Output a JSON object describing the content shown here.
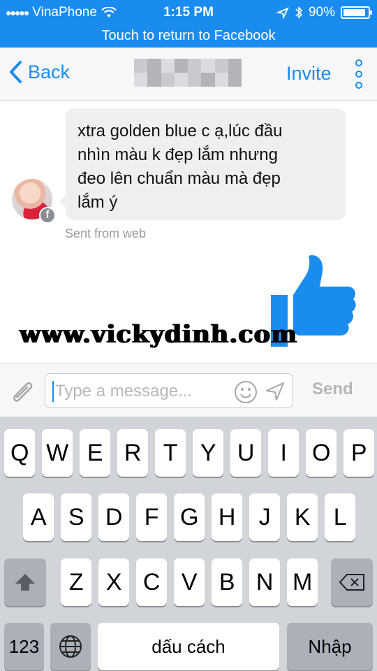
{
  "status_bar": {
    "carrier": "VinaPhone",
    "time": "1:15 PM",
    "battery": "90%",
    "battery_level": 0.9
  },
  "return_banner": "Touch to return to Facebook",
  "nav": {
    "back_label": "Back",
    "invite_label": "Invite"
  },
  "message": {
    "lines": [
      "xtra golden blue c ạ,lúc đầu",
      "nhìn màu k đẹp lắm nhưng",
      "đeo lên chuẩn màu mà đẹp",
      "lắm ý"
    ],
    "meta": "Sent from web"
  },
  "watermark": "www.vickydinh.com",
  "composer": {
    "placeholder": "Type a message...",
    "send_label": "Send"
  },
  "keyboard": {
    "row1": [
      "Q",
      "W",
      "E",
      "R",
      "T",
      "Y",
      "U",
      "I",
      "O",
      "P"
    ],
    "row2": [
      "A",
      "S",
      "D",
      "F",
      "G",
      "H",
      "J",
      "K",
      "L"
    ],
    "row3": [
      "Z",
      "X",
      "C",
      "V",
      "B",
      "N",
      "M"
    ],
    "numbers_label": "123",
    "space_label": "dấu cách",
    "return_label": "Nhập"
  },
  "colors": {
    "accent": "#1a8cf0",
    "bubble": "#efeff1",
    "keyboard_bg": "#d1d4d9"
  },
  "icons": [
    "wifi-icon",
    "location-arrow-icon",
    "bluetooth-icon",
    "chevron-left-icon",
    "more-vertical-icon",
    "facebook-badge-icon",
    "like-thumb-icon",
    "paperclip-icon",
    "emoji-icon",
    "send-location-icon",
    "shift-icon",
    "backspace-icon",
    "globe-icon"
  ]
}
